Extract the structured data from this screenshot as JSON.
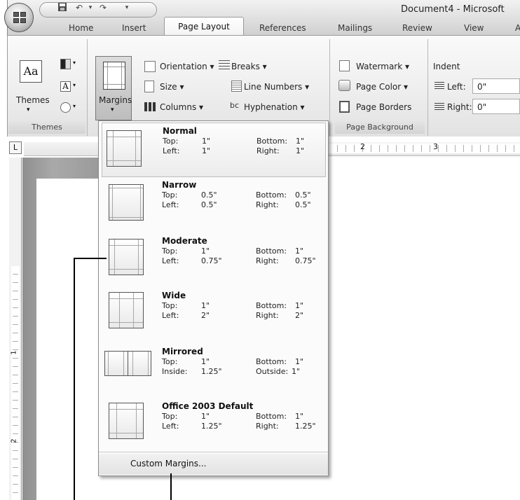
{
  "window": {
    "title": "Document4 - Microsoft"
  },
  "qat": {
    "undo_glyph": "↶",
    "redo_glyph": "↷",
    "dropdown_glyph": "▾"
  },
  "tabs": [
    {
      "label": "Home"
    },
    {
      "label": "Insert"
    },
    {
      "label": "Page Layout"
    },
    {
      "label": "References"
    },
    {
      "label": "Mailings"
    },
    {
      "label": "Review"
    },
    {
      "label": "View"
    },
    {
      "label": "A"
    }
  ],
  "ribbon": {
    "themes": {
      "button_label": "Themes",
      "group_label": "Themes",
      "icon_text": "Aa",
      "fonts_icon_text": "A"
    },
    "page_setup": {
      "margins_label": "Margins",
      "orientation": "Orientation ▾",
      "size": "Size ▾",
      "columns": "Columns ▾",
      "breaks": "Breaks ▾",
      "line_numbers": "Line Numbers ▾",
      "hyphenation": "Hyphenation ▾",
      "hyphenation_icon_text": "bc"
    },
    "page_background": {
      "watermark": "Watermark ▾",
      "page_color": "Page Color ▾",
      "page_borders": "Page Borders",
      "group_label": "Page Background"
    },
    "paragraph": {
      "indent_label": "Indent",
      "left_label": "Left:",
      "left_value": "0\"",
      "right_label": "Right:",
      "right_value": "0\""
    }
  },
  "ruler": {
    "corner_glyph": "L",
    "mark_2": "2",
    "mark_3": "3",
    "v_mark_1": "1",
    "v_mark_2": "2"
  },
  "margins_menu": {
    "presets": [
      {
        "name": "Normal",
        "l1a": "Top:",
        "v1a": "1\"",
        "l1b": "Bottom:",
        "v1b": "1\"",
        "l2a": "Left:",
        "v2a": "1\"",
        "l2b": "Right:",
        "v2b": "1\""
      },
      {
        "name": "Narrow",
        "l1a": "Top:",
        "v1a": "0.5\"",
        "l1b": "Bottom:",
        "v1b": "0.5\"",
        "l2a": "Left:",
        "v2a": "0.5\"",
        "l2b": "Right:",
        "v2b": "0.5\""
      },
      {
        "name": "Moderate",
        "l1a": "Top:",
        "v1a": "1\"",
        "l1b": "Bottom:",
        "v1b": "1\"",
        "l2a": "Left:",
        "v2a": "0.75\"",
        "l2b": "Right:",
        "v2b": "0.75\""
      },
      {
        "name": "Wide",
        "l1a": "Top:",
        "v1a": "1\"",
        "l1b": "Bottom:",
        "v1b": "1\"",
        "l2a": "Left:",
        "v2a": "2\"",
        "l2b": "Right:",
        "v2b": "2\""
      },
      {
        "name": "Mirrored",
        "l1a": "Top:",
        "v1a": "1\"",
        "l1b": "Bottom:",
        "v1b": "1\"",
        "l2a": "Inside:",
        "v2a": "1.25\"",
        "l2b": "Outside:",
        "v2b": "1\""
      },
      {
        "name": "Office 2003 Default",
        "l1a": "Top:",
        "v1a": "1\"",
        "l1b": "Bottom:",
        "v1b": "1\"",
        "l2a": "Left:",
        "v2a": "1.25\"",
        "l2b": "Right:",
        "v2b": "1.25\""
      }
    ],
    "custom_label": "Custom Margins..."
  }
}
